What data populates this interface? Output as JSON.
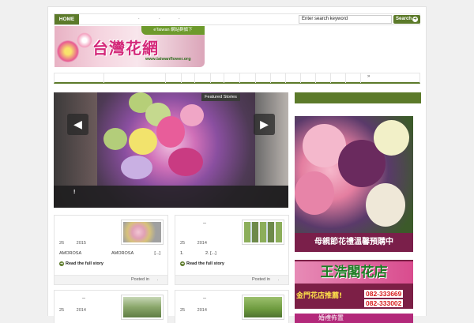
{
  "header": {
    "home_label": "HOME",
    "nav_dots": [
      ".",
      ".",
      "."
    ],
    "search_placeholder": "Enter search keyword",
    "search_button": "Search"
  },
  "logo": {
    "tagline": "eTaiwan 網站群旗下",
    "title": "台灣花網",
    "url": "www.taiwanflower.org"
  },
  "menu": {
    "more_arrow": "»"
  },
  "slider": {
    "label": "Featured Stories",
    "prev_arrow": "◀",
    "next_arrow": "▶",
    "caption": "!"
  },
  "sidebar": {
    "ad1_text": "母親節花禮溫馨預購中",
    "ad2_title": "王浩閣花店",
    "ad2_sub": "金門花店推薦!",
    "ad2_phone1": "082-333669",
    "ad2_phone2": "082-333002",
    "ad3_text": "婚禮佈置"
  },
  "cards": [
    {
      "title": "",
      "day": "26",
      "year": "2015",
      "excerpt_left": "AMOROSA",
      "excerpt_mid": "AMOROSA",
      "excerpt_right": "[...]",
      "readmore": "Read the full story",
      "footer": "Posted in",
      "footer_tail": "."
    },
    {
      "title": "--",
      "day": "25",
      "year": "2014",
      "excerpt_left": "1.",
      "excerpt_mid": "2.   [...]",
      "excerpt_right": "",
      "readmore": "Read the full story",
      "footer": "Posted in",
      "footer_tail": "."
    },
    {
      "title": "--",
      "day": "25",
      "year": "2014"
    },
    {
      "title": "--",
      "day": "25",
      "year": "2014"
    }
  ],
  "colors": {
    "accent": "#5c7a2a",
    "ad_magenta": "#7a1f4a"
  }
}
